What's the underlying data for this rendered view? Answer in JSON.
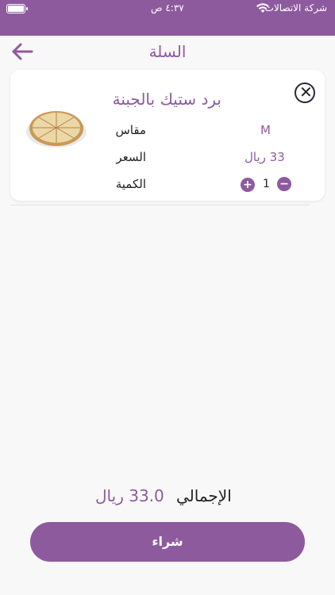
{
  "status_bar": {
    "time": "٤:٣٧ ص",
    "carrier": "شركة الاتصالات"
  },
  "nav": {
    "title": "السلة"
  },
  "cart_item": {
    "name": "برد ستيك بالجبنة",
    "size_label": "مقاس",
    "size_value": "M",
    "price_label": "السعر",
    "price_value": "33 ريال",
    "quantity_label": "الكمية",
    "quantity_value": "1",
    "plus": "+",
    "minus": "−",
    "remove": "✕"
  },
  "summary": {
    "total_label": "الإجمالي",
    "total_value": "33.0 ريال"
  },
  "actions": {
    "buy_label": "شراء"
  },
  "colors": {
    "brand": "#8e5a9e",
    "background": "#f8f8f8"
  }
}
